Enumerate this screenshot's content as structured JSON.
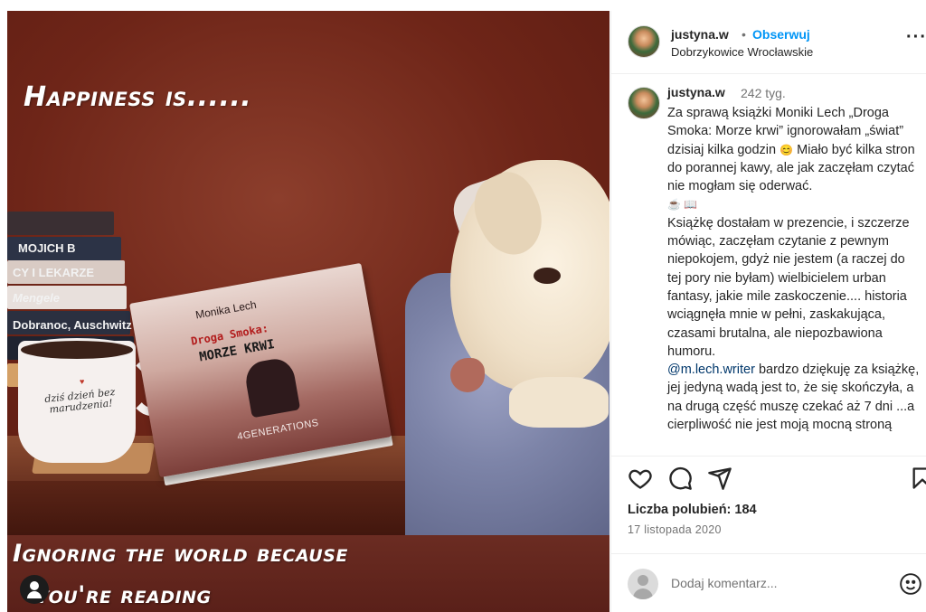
{
  "photo": {
    "caption_top": "Happiness is......",
    "caption_bottom_line1": "Ignoring the world because",
    "caption_bottom_line2": "you're reading",
    "books": [
      "MOJICH B",
      "CY I LEKARZE",
      "Mengele",
      "Dobranoc, Auschwitz"
    ],
    "mug_text": "dziś dzień bez marudzenia!",
    "novel": {
      "author": "Monika Lech",
      "title_line1": "Droga Smoka:",
      "title_line2": "MORZE KRWI",
      "publisher": "4GENERATIONS"
    },
    "tag_icon": "person-tag-icon"
  },
  "post": {
    "username": "justyna.w",
    "separator": "•",
    "follow_label": "Obserwuj",
    "location": "Dobrzykowice Wrocławskie",
    "more_icon": "more-options-icon",
    "comment_author": "justyna.w",
    "comment_time": "242 tyg.",
    "caption_p1": "Za sprawą książki Moniki Lech „Droga Smoka: Morze krwi” ignorowałam „świat” dzisiaj kilka godzin",
    "caption_p1_emoji": "😊",
    "caption_p1_rest": "Miało być kilka stron do porannej kawy, ale jak zaczęłam czytać nie mogłam się oderwać.",
    "caption_emojis": "☕ 📖",
    "caption_p2": "Książkę dostałam w prezencie, i szczerze mówiąc, zaczęłam czytanie z pewnym niepokojem, gdyż nie jestem (a raczej do tej pory nie byłam) wielbicielem urban fantasy,  jakie mile zaskoczenie.... historia wciągnęła mnie w pełni, zaskakująca, czasami brutalna, ale niepozbawiona humoru.",
    "caption_mention": "@m.lech.writer",
    "caption_p3": "bardzo dziękuję za książkę, jej jedyną wadą jest to, że się skończyła, a na drugą część muszę czekać aż 7 dni ...a cierpliwość nie jest moją mocną stroną",
    "likes_label": "Liczba polubień: 184",
    "date": "17 listopada 2020",
    "comment_placeholder": "Dodaj komentarz...",
    "colors": {
      "accent": "#0095f6",
      "text": "#262626",
      "muted": "#737373",
      "mention": "#00376b",
      "border": "#efefef"
    },
    "icons": [
      "heart-icon",
      "comment-icon",
      "share-icon",
      "save-icon",
      "emoji-icon"
    ]
  }
}
